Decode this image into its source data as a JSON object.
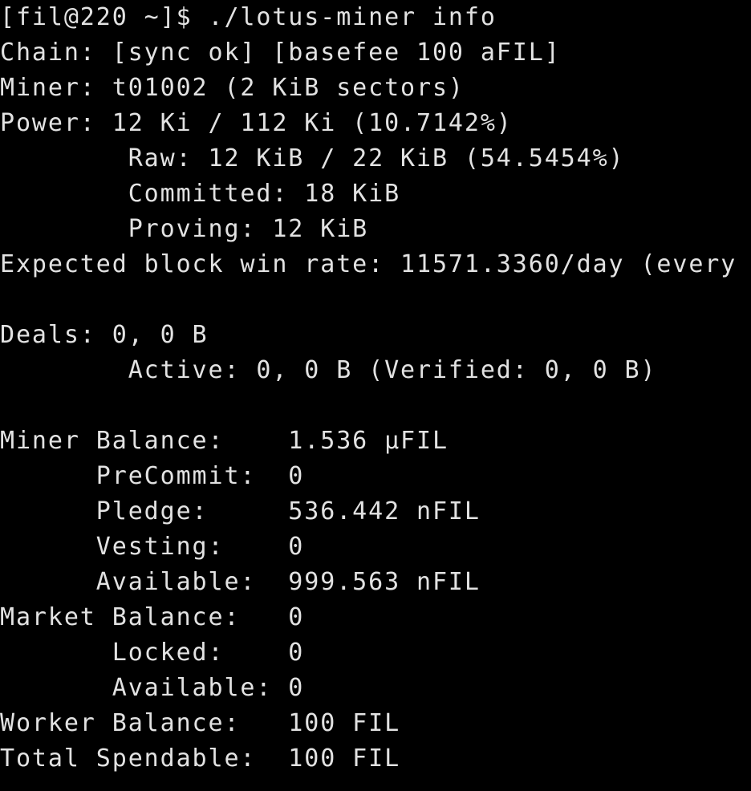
{
  "terminal": {
    "colors": {
      "background": "#000000",
      "foreground": "#e2e2e2"
    },
    "lines": [
      "[fil@220 ~]$ ./lotus-miner info",
      "Chain: [sync ok] [basefee 100 aFIL]",
      "Miner: t01002 (2 KiB sectors)",
      "Power: 12 Ki / 112 Ki (10.7142%)",
      "        Raw: 12 KiB / 22 KiB (54.5454%)",
      "        Committed: 18 KiB",
      "        Proving: 12 KiB",
      "Expected block win rate: 11571.3360/day (every",
      "",
      "Deals: 0, 0 B",
      "        Active: 0, 0 B (Verified: 0, 0 B)",
      "",
      "Miner Balance:    1.536 μFIL",
      "      PreCommit:  0",
      "      Pledge:     536.442 nFIL",
      "      Vesting:    0",
      "      Available:  999.563 nFIL",
      "Market Balance:   0",
      "       Locked:    0",
      "       Available: 0",
      "Worker Balance:   100 FIL",
      "Total Spendable:  100 FIL"
    ]
  }
}
